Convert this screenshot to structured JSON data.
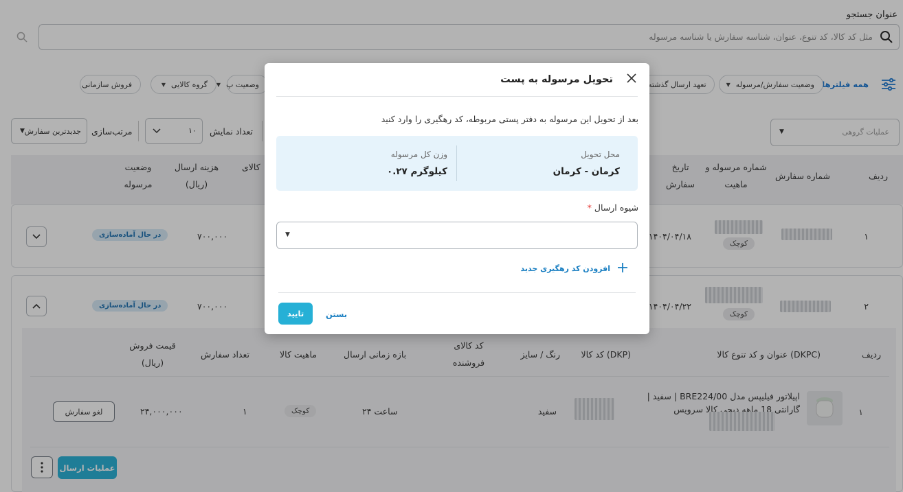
{
  "search": {
    "label": "عنوان جستجو",
    "placeholder": "مثل کد کالا، کد تنوع، عنوان، شناسه سفارش یا شناسه مرسوله"
  },
  "filters": {
    "all_filters": "همه فیلترها",
    "chips": [
      "وضعیت سفارش/مرسوله",
      "تعهد ارسال گذشته",
      "وضعیت پ",
      "گروه کالایی",
      "فروش سازمانی"
    ]
  },
  "controls": {
    "bulk_placeholder": "عملیات گروهی",
    "page_size_label": "تعداد نمایش",
    "page_size_value": "۱۰",
    "sort_label": "مرتب‌سازی",
    "sort_value": "جدیدترین سفارش"
  },
  "table": {
    "headers": {
      "row": "ردیف",
      "order_no": "شماره سفارش",
      "shipment_no": "شماره مرسوله و ماهیت",
      "order_date": "تاریخ سفارش",
      "items": "کالای",
      "shipping_cost": "هزینه ارسال (ریال)",
      "status": "وضعیت مرسوله"
    },
    "rows": [
      {
        "row": "۱",
        "size_badge": "کوچک",
        "date": "۱۴۰۴/۰۴/۱۸",
        "shipping_cost": "۷۰۰,۰۰۰",
        "status": "در حال آماده‌سازی"
      },
      {
        "row": "۲",
        "size_badge": "کوچک",
        "date": "۱۴۰۴/۰۴/۲۲",
        "shipping_cost": "۷۰۰,۰۰۰",
        "status": "در حال آماده‌سازی"
      }
    ]
  },
  "items_table": {
    "headers": {
      "row": "ردیف",
      "title": "عنوان و کد تنوع کالا (DKPC)",
      "dkp": "کد کالا (DKP)",
      "color": "رنگ / سایز",
      "seller_code": "کد کالای فروشنده",
      "window": "بازه زمانی ارسال",
      "nature": "ماهیت کالا",
      "qty": "تعداد سفارش",
      "price": "قیمت فروش (ریال)"
    },
    "row": {
      "row": "۱",
      "title": "اپیلاتور فیلیپس مدل BRE224/00 | سفید | گارانتی 18 ماهه دیجی کالا سرویس",
      "color": "سفید",
      "window": "۲۴ ساعت",
      "nature": "کوچک",
      "qty": "۱",
      "price": "۲۴,۰۰۰,۰۰۰",
      "cancel": "لغو سفارش"
    },
    "shipping_ops": "عملیات ارسال"
  },
  "modal": {
    "title": "تحویل مرسوله به پست",
    "description": "بعد از تحویل این مرسوله به دفتر پستی مربوطه، کد رهگیری را وارد کنید",
    "place_label": "محل تحویل",
    "place_value": "کرمان - کرمان",
    "weight_label": "وزن کل مرسوله",
    "weight_value": "۰.۲۷ کیلوگرم",
    "method_label": "شیوه ارسال",
    "required_mark": "*",
    "add_tracking": "افزودن کد رهگیری جدید",
    "confirm": "تایید",
    "close": "بستن"
  },
  "colors": {
    "accent": "#26b0d6",
    "link": "#1a7fc2"
  }
}
